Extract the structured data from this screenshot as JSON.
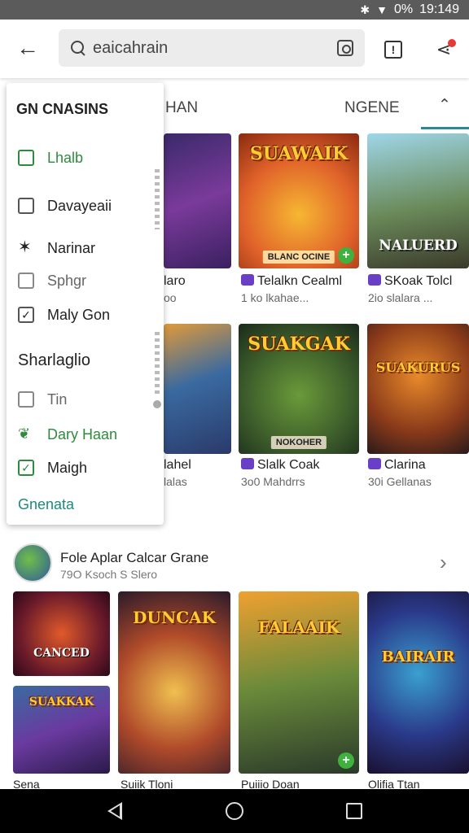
{
  "status": {
    "battery": "0%",
    "time": "19:149"
  },
  "search": {
    "query": "eaicahrain"
  },
  "tabs": {
    "left": "HAN",
    "right": "NGENE"
  },
  "drawer": {
    "title": "GN CNASINS",
    "items": [
      {
        "label": "Lhalb"
      },
      {
        "label": "Davayeaii"
      },
      {
        "label": "Narinar"
      },
      {
        "label": "Sphgr"
      },
      {
        "label": "Maly Gon"
      }
    ],
    "section": "Sharlaglio",
    "section_items": [
      {
        "label": "Tin"
      },
      {
        "label": "Dary Haan"
      },
      {
        "label": "Maigh"
      }
    ],
    "footer": "Gnenata"
  },
  "cards": [
    {
      "title": "laro",
      "sub": "oo"
    },
    {
      "title": "Telalkn Cealml",
      "sub": "1 ko lkahae...",
      "logo": "SUAWAIK",
      "banner": "BLANC OCINE"
    },
    {
      "title": "SKoak Tolcl",
      "sub": "2io slalara ...",
      "logo": "NALUERD"
    },
    {
      "title": "lahel",
      "sub": "lalas"
    },
    {
      "title": "Slalk Coak",
      "sub": "3o0 Mahdrrs",
      "logo": "SUAKGAK",
      "banner": "NOKOHER"
    },
    {
      "title": "Clarina",
      "sub": "30i Gellanas",
      "logo": "SUAKURUS"
    }
  ],
  "section": {
    "title": "Fole Aplar Calcar Grane",
    "sub": "79O Ksoch S Slero"
  },
  "bottom_cards": [
    {
      "logo": "CANCED"
    },
    {
      "logo": "DUNCAK"
    },
    {
      "logo": "FALAAIK"
    },
    {
      "logo": "BAIRAIR"
    },
    {
      "logo": "SUAKKAK"
    }
  ],
  "bottom_labels": [
    "Sena",
    "Suiik Tloni",
    "Puiiio Doan",
    "Olifia Ttan"
  ]
}
